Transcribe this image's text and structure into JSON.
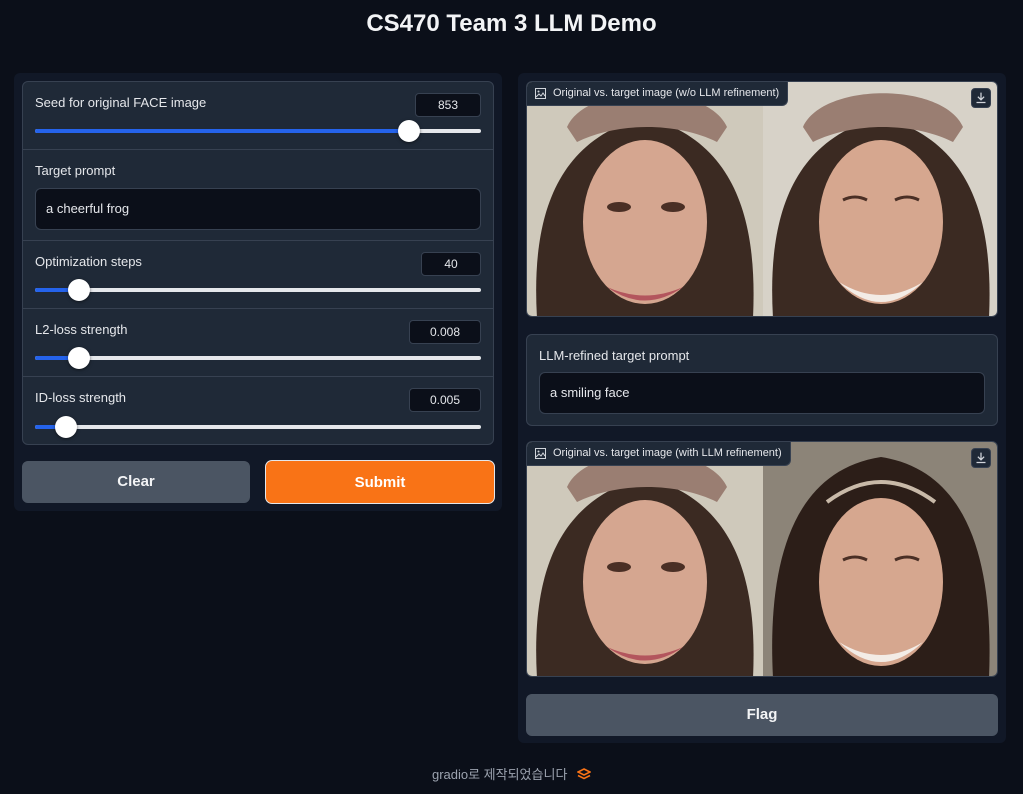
{
  "app": {
    "title": "CS470 Team 3 LLM Demo"
  },
  "inputs": {
    "seed": {
      "label": "Seed for original FACE image",
      "value": "853",
      "fraction": 0.838
    },
    "target_prompt": {
      "label": "Target prompt",
      "value": "a cheerful frog"
    },
    "steps": {
      "label": "Optimization steps",
      "value": "40",
      "fraction": 0.098
    },
    "l2": {
      "label": "L2-loss strength",
      "value": "0.008",
      "fraction": 0.098
    },
    "id": {
      "label": "ID-loss strength",
      "value": "0.005",
      "fraction": 0.069
    }
  },
  "buttons": {
    "clear": "Clear",
    "submit": "Submit",
    "flag": "Flag"
  },
  "outputs": {
    "image1_label": "Original vs. target image (w/o LLM refinement)",
    "refined_prompt_label": "LLM-refined target prompt",
    "refined_prompt_value": "a smiling face",
    "image2_label": "Original vs. target image (with LLM refinement)"
  },
  "footer": {
    "text": "gradio로 제작되었습니다"
  },
  "colors": {
    "accent": "#f97316",
    "slider": "#2563eb",
    "background": "#0b0f19",
    "panel": "#1f2937"
  }
}
